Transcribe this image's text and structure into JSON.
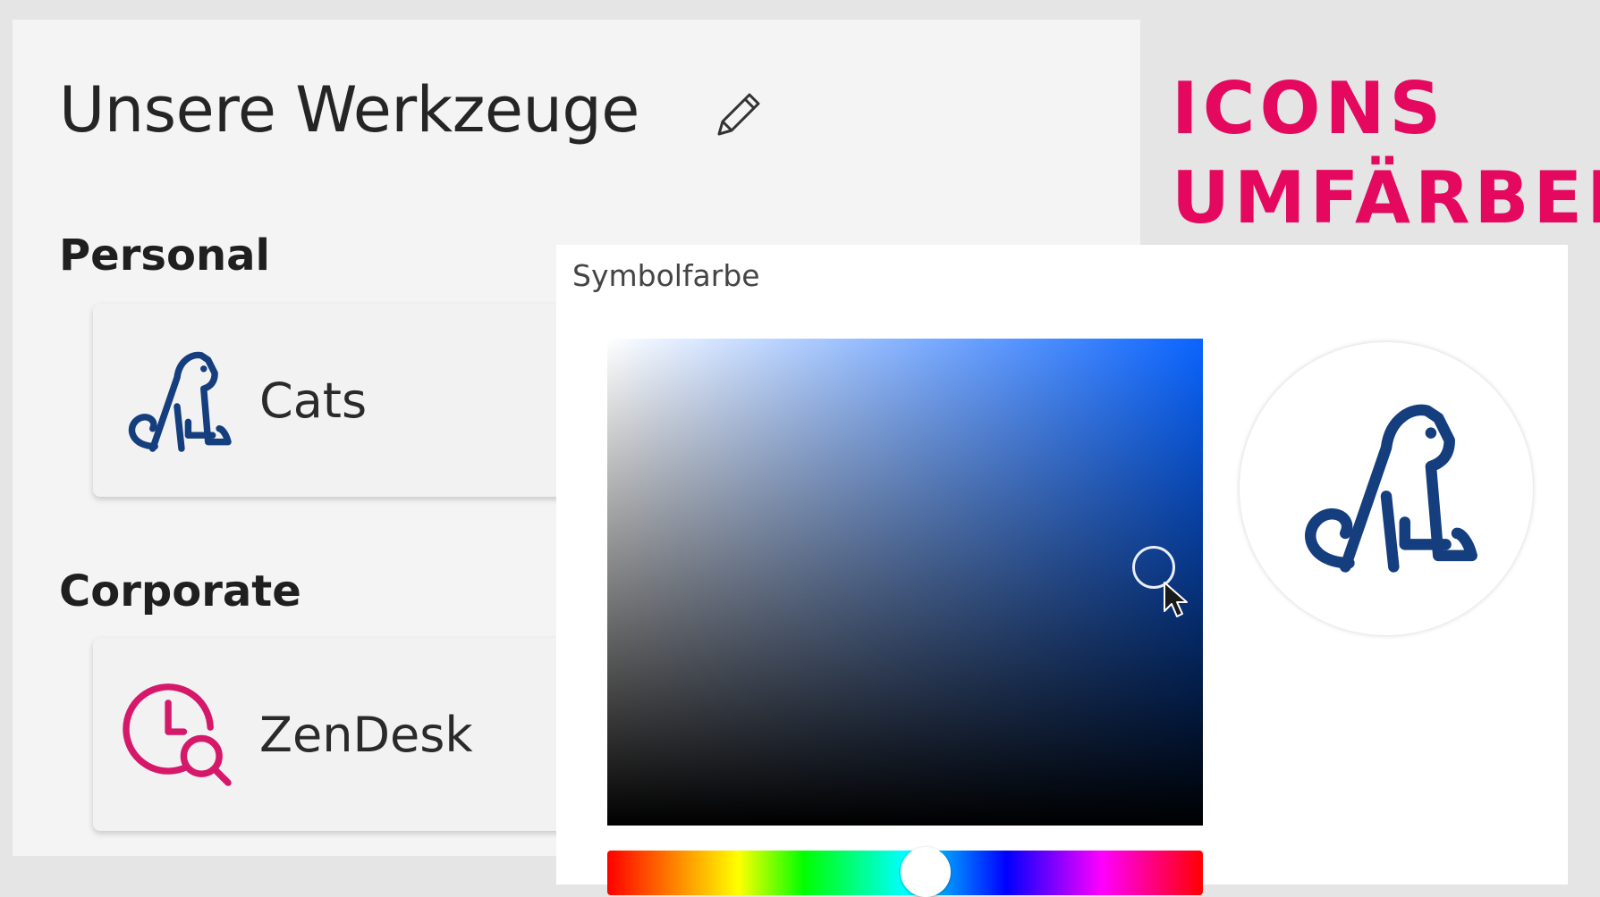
{
  "page": {
    "title": "Unsere Werkzeuge",
    "edit_icon": "pencil-icon"
  },
  "sections": [
    {
      "heading": "Personal",
      "items": [
        {
          "label": "Cats",
          "icon": "cat-icon",
          "icon_color": "#153e7e"
        }
      ]
    },
    {
      "heading": "Corporate",
      "items": [
        {
          "label": "ZenDesk",
          "icon": "clock-search-icon",
          "icon_color": "#d6186b"
        }
      ]
    }
  ],
  "headline": {
    "line1": "ICONS",
    "line2": "UMFÄRBEN",
    "color": "#e4095f"
  },
  "color_picker": {
    "title": "Symbolfarbe",
    "hue_color": "#0a64ff",
    "selected_color": "#153e7e",
    "preview_icon": "cat-icon"
  }
}
